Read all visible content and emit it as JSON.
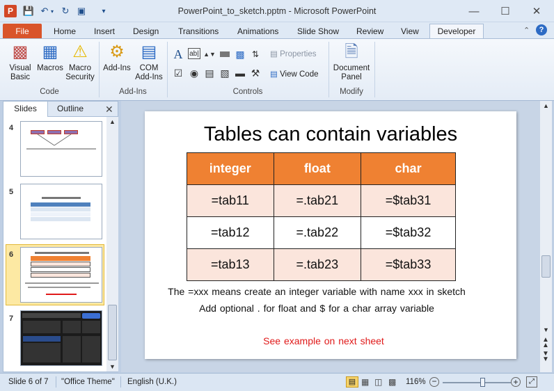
{
  "window": {
    "title": "PowerPoint_to_sketch.pptm - Microsoft PowerPoint",
    "app_icon": "P"
  },
  "tabs": [
    "File",
    "Home",
    "Insert",
    "Design",
    "Transitions",
    "Animations",
    "Slide Show",
    "Review",
    "View",
    "Developer"
  ],
  "ribbon": {
    "code": {
      "label": "Code",
      "visual_basic": "Visual\nBasic",
      "macros": "Macros",
      "macro_security": "Macro\nSecurity"
    },
    "addins": {
      "label": "Add-Ins",
      "add_ins": "Add-Ins",
      "com_add_ins": "COM\nAdd-Ins"
    },
    "controls": {
      "label": "Controls",
      "properties": "Properties",
      "view_code": "View Code"
    },
    "modify": {
      "label": "Modify",
      "document_panel": "Document\nPanel"
    }
  },
  "pane": {
    "tabs": [
      "Slides",
      "Outline"
    ],
    "slides": [
      {
        "num": "4"
      },
      {
        "num": "5"
      },
      {
        "num": "6"
      },
      {
        "num": "7"
      }
    ]
  },
  "slide": {
    "title": "Tables can contain variables",
    "headers": [
      "integer",
      "float",
      "char"
    ],
    "rows": [
      [
        "=tab11",
        "=.tab21",
        "=$tab31"
      ],
      [
        "=tab12",
        "=.tab22",
        "=$tab32"
      ],
      [
        "=tab13",
        "=.tab23",
        "=$tab33"
      ]
    ],
    "line1": "The =xxx means create an integer variable with name xxx in sketch",
    "line2": "Add optional . for float and $ for a char array variable",
    "example": "See example on next sheet"
  },
  "status": {
    "slide_info": "Slide 6 of 7",
    "theme": "\"Office Theme\"",
    "language": "English (U.K.)",
    "zoom": "116%"
  },
  "zoom_fraction": 0.58,
  "colors": {
    "accent": "#ef8132",
    "file_tab": "#d9542a",
    "example_text": "#e01a1a"
  }
}
